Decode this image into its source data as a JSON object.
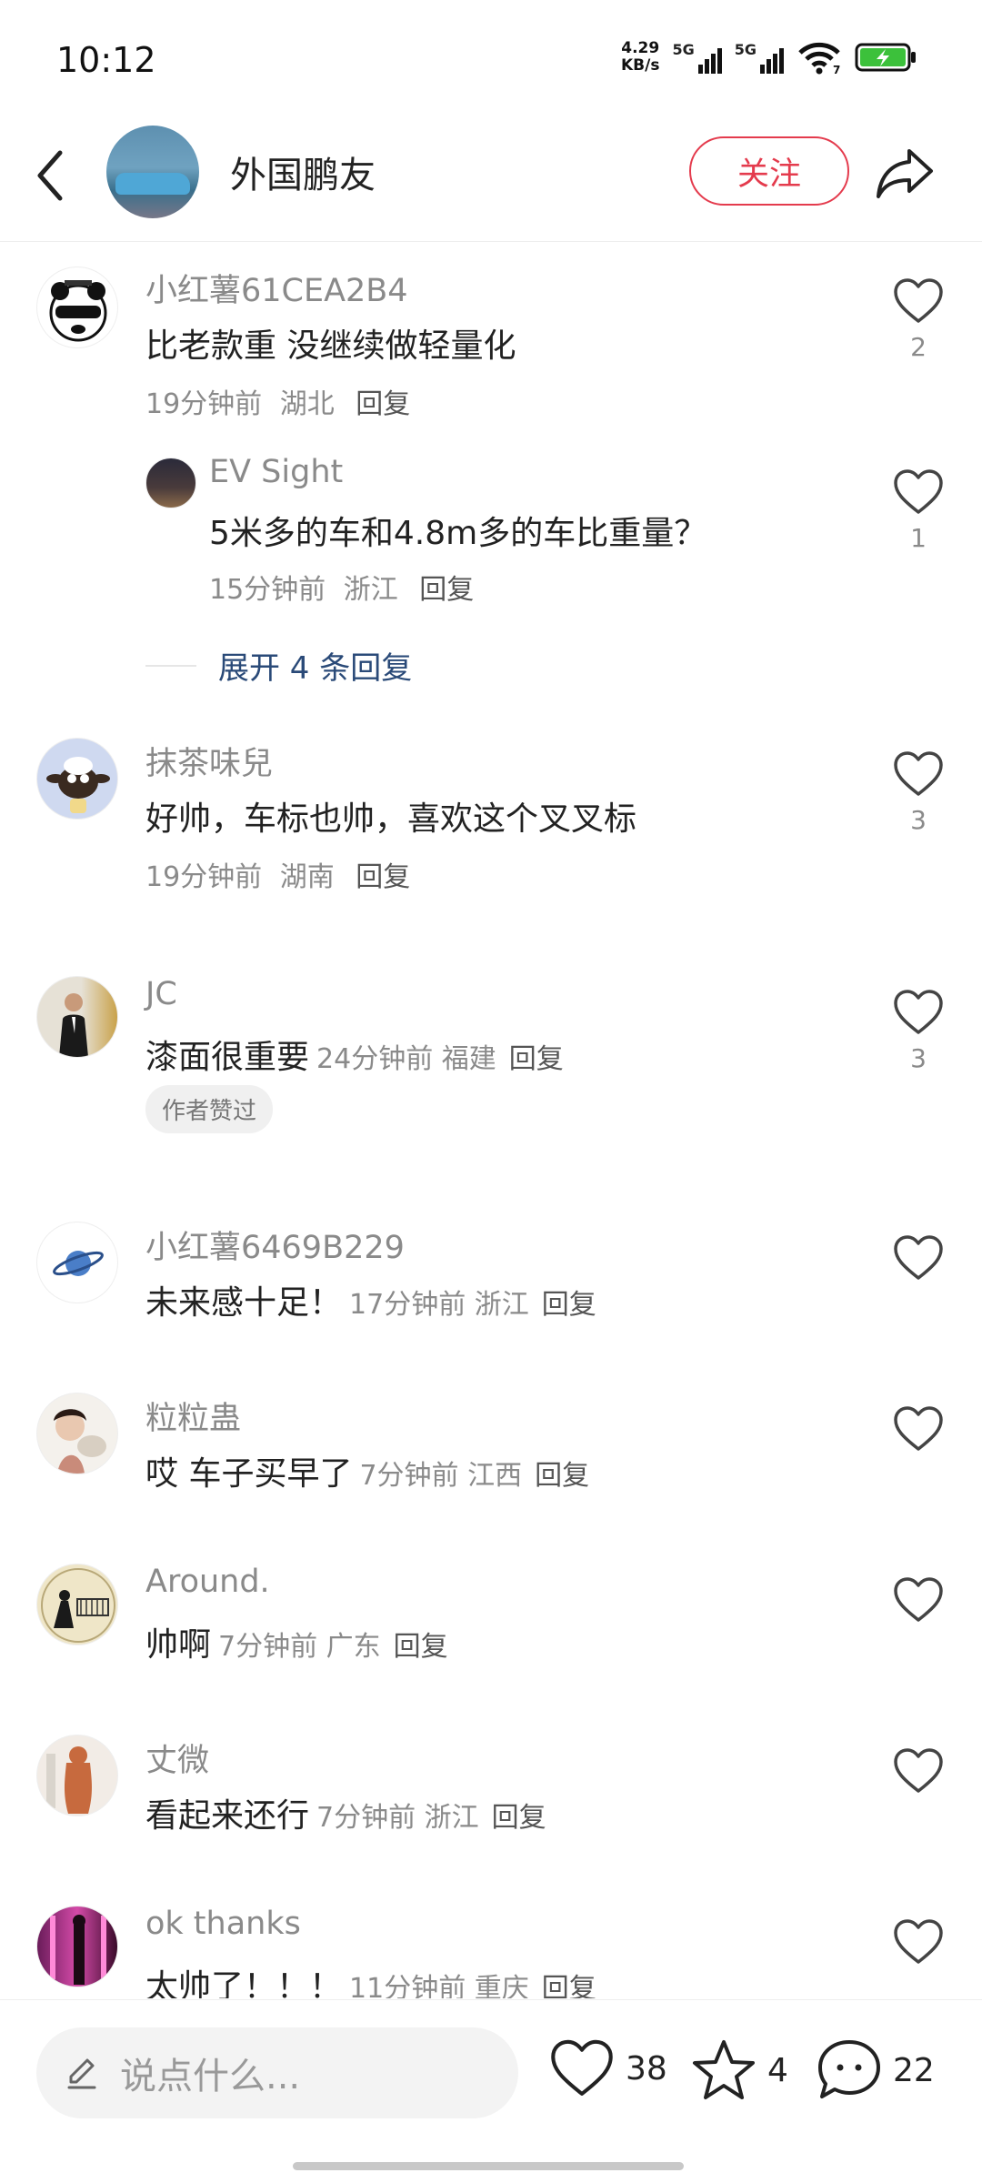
{
  "status_bar": {
    "time": "10:12",
    "speed_value": "4.29",
    "speed_unit": "KB/s",
    "sim1": "5G",
    "sim2": "5G",
    "wifi_badge": "7"
  },
  "header": {
    "name": "外国鹏友",
    "follow_label": "关注"
  },
  "comments": [
    {
      "user": "小红薯61CEA2B4",
      "text": "比老款重 没继续做轻量化",
      "time": "19分钟前",
      "location": "湖北",
      "reply_label": "回复",
      "likes": "2",
      "replies": [
        {
          "user": "EV Sight",
          "text": "5米多的车和4.8m多的车比重量？",
          "time": "15分钟前",
          "location": "浙江",
          "reply_label": "回复",
          "likes": "1"
        }
      ],
      "expand_label": "展开 4 条回复"
    },
    {
      "user": "抹茶味兒",
      "text": "好帅，车标也帅，喜欢这个叉叉标",
      "time": "19分钟前",
      "location": "湖南",
      "reply_label": "回复",
      "likes": "3"
    },
    {
      "user": "JC",
      "text": "漆面很重要",
      "time": "24分钟前",
      "location": "福建",
      "reply_label": "回复",
      "likes": "3",
      "badge": "作者赞过"
    },
    {
      "user": "小红薯6469B229",
      "text": "未来感十足！",
      "time": "17分钟前",
      "location": "浙江",
      "reply_label": "回复"
    },
    {
      "user": "粒粒蛊",
      "text": "哎 车子买早了",
      "time": "7分钟前",
      "location": "江西",
      "reply_label": "回复"
    },
    {
      "user": "Around.",
      "text": "帅啊",
      "time": "7分钟前",
      "location": "广东",
      "reply_label": "回复"
    },
    {
      "user": "丈微",
      "text": "看起来还行",
      "time": "7分钟前",
      "location": "浙江",
      "reply_label": "回复"
    },
    {
      "user": "ok thanks",
      "text": "太帅了！！！",
      "time": "11分钟前",
      "location": "重庆",
      "reply_label": "回复"
    }
  ],
  "bottom_bar": {
    "input_placeholder": "说点什么...",
    "likes": "38",
    "stars": "4",
    "comments": "22"
  },
  "icons": {
    "back": "chevron-left-icon",
    "share": "share-arrow-icon",
    "like": "heart-outline-icon",
    "star": "star-outline-icon",
    "comment": "chat-bubble-icon",
    "pencil": "pencil-icon"
  },
  "colors": {
    "accent": "#e43b4d",
    "link": "#2a4a78",
    "muted": "#8a8a8a",
    "battery": "#3cc13b"
  }
}
